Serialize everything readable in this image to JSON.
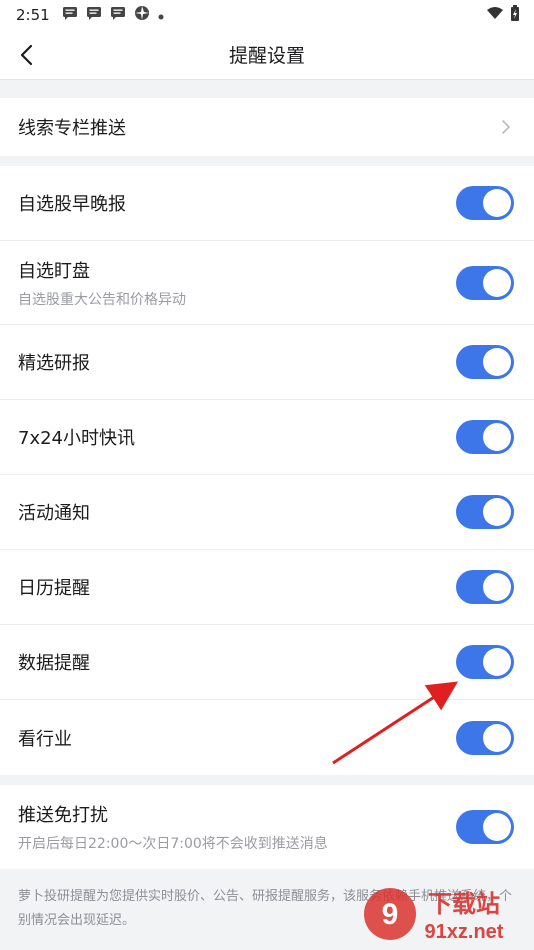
{
  "status": {
    "time": "2:51"
  },
  "nav": {
    "title": "提醒设置"
  },
  "clue": {
    "label": "线索专栏推送"
  },
  "settings": [
    {
      "label": "自选股早晚报",
      "sub": "",
      "on": true
    },
    {
      "label": "自选盯盘",
      "sub": "自选股重大公告和价格异动",
      "on": true
    },
    {
      "label": "精选研报",
      "sub": "",
      "on": true
    },
    {
      "label": "7x24小时快讯",
      "sub": "",
      "on": true
    },
    {
      "label": "活动通知",
      "sub": "",
      "on": true
    },
    {
      "label": "日历提醒",
      "sub": "",
      "on": true
    },
    {
      "label": "数据提醒",
      "sub": "",
      "on": true
    },
    {
      "label": "看行业",
      "sub": "",
      "on": true
    }
  ],
  "dnd": {
    "label": "推送免打扰",
    "sub": "开启后每日22:00～次日7:00将不会收到推送消息",
    "on": true
  },
  "footnote": "萝卜投研提醒为您提供实时股价、公告、研报提醒服务，该服务依赖手机推送系统，个别情况会出现延迟。",
  "watermark": {
    "brand": "下载站",
    "domain": "91xz.net"
  },
  "colors": {
    "accent": "#3c76e8",
    "arrow": "#e02020"
  }
}
